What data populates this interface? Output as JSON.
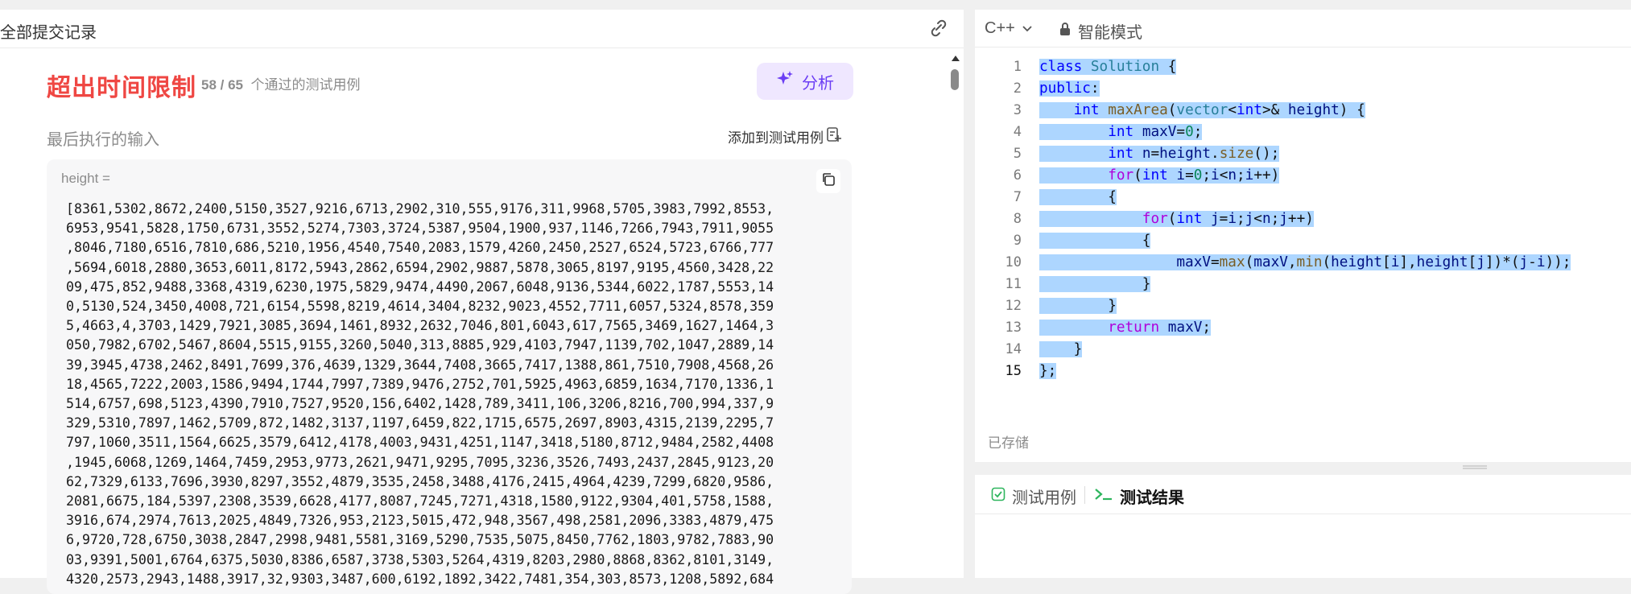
{
  "left_panel": {
    "title": "全部提交记录",
    "status": "超出时间限制",
    "passed_count": "58 / 65",
    "passed_label": "个通过的测试用例",
    "analyze_label": "分析",
    "last_input_label": "最后执行的输入",
    "add_to_tests_label": "添加到测试用例",
    "input_var_label": "height =",
    "input_lines": [
      "[8361,5302,8672,2400,5150,3527,9216,6713,2902,310,555,9176,311,9968,5705,3983,7992,8553,",
      "6953,9541,5828,1750,6731,3552,5274,7303,3724,5387,9504,1900,937,1146,7266,7943,7911,9055",
      ",8046,7180,6516,7810,686,5210,1956,4540,7540,2083,1579,4260,2450,2527,6524,5723,6766,777",
      ",5694,6018,2880,3653,6011,8172,5943,2862,6594,2902,9887,5878,3065,8197,9195,4560,3428,22",
      "09,475,852,9488,3368,4319,6230,1975,5829,9474,4490,2067,6048,9136,5344,6022,1787,5553,14",
      "0,5130,524,3450,4008,721,6154,5598,8219,4614,3404,8232,9023,4552,7711,6057,5324,8578,359",
      "5,4663,4,3703,1429,7921,3085,3694,1461,8932,2632,7046,801,6043,617,7565,3469,1627,1464,3",
      "050,7982,6702,5467,8604,5515,9155,3260,5040,313,8885,929,4103,7947,1139,702,1047,2889,14",
      "39,3945,4738,2462,8491,7699,376,4639,1329,3644,7408,3665,7417,1388,861,7510,7908,4568,26",
      "18,4565,7222,2003,1586,9494,1744,7997,7389,9476,2752,701,5925,4963,6859,1634,7170,1336,1",
      "514,6757,698,5123,4390,7910,7527,9520,156,6402,1428,789,3411,106,3206,8216,700,994,337,9",
      "329,5310,7897,1462,5709,872,1482,3137,1197,6459,822,1715,6575,2697,8903,4315,2139,2295,7",
      "797,1060,3511,1564,6625,3579,6412,4178,4003,9431,4251,1147,3418,5180,8712,9484,2582,4408",
      ",1945,6068,1269,1464,7459,2953,9773,2621,9471,9295,7095,3236,3526,7493,2437,2845,9123,20",
      "62,7329,6133,7696,3930,8297,3552,4879,3535,2458,3488,4176,2415,4964,4239,7299,6820,9586,",
      "2081,6675,184,5397,2308,3539,6628,4177,8087,7245,7271,4318,1580,9122,9304,401,5758,1588,",
      "3916,674,2974,7613,2025,4849,7326,953,2123,5015,472,948,3567,498,2581,2096,3383,4879,475",
      "6,9720,728,6750,3038,2847,2998,9481,5581,3169,5290,7535,5075,8450,7762,1803,9782,7883,90",
      "03,9391,5001,6764,6375,5030,8386,6587,3738,5303,5264,4319,8203,2980,8868,8362,8101,3149,",
      "4320,2573,2943,1488,3917,32,9303,3487,600,6192,1892,3422,7481,354,303,8573,1208,5892,684"
    ]
  },
  "editor": {
    "language": "C++",
    "mode_label": "智能模式",
    "saved_label": "已存储",
    "code_lines": [
      [
        {
          "t": "class",
          "c": "kw"
        },
        {
          "t": " "
        },
        {
          "t": "Solution",
          "c": "ty"
        },
        {
          "t": " {"
        }
      ],
      [
        {
          "t": "public",
          "c": "kw"
        },
        {
          "t": ":"
        }
      ],
      [
        {
          "t": "    "
        },
        {
          "t": "int",
          "c": "kw"
        },
        {
          "t": " "
        },
        {
          "t": "maxArea",
          "c": "fn"
        },
        {
          "t": "("
        },
        {
          "t": "vector",
          "c": "ty"
        },
        {
          "t": "<"
        },
        {
          "t": "int",
          "c": "kw"
        },
        {
          "t": ">& "
        },
        {
          "t": "height",
          "c": "var"
        },
        {
          "t": ") {"
        }
      ],
      [
        {
          "t": "        "
        },
        {
          "t": "int",
          "c": "kw"
        },
        {
          "t": " "
        },
        {
          "t": "maxV",
          "c": "var"
        },
        {
          "t": "="
        },
        {
          "t": "0",
          "c": "num"
        },
        {
          "t": ";"
        }
      ],
      [
        {
          "t": "        "
        },
        {
          "t": "int",
          "c": "kw"
        },
        {
          "t": " "
        },
        {
          "t": "n",
          "c": "var"
        },
        {
          "t": "="
        },
        {
          "t": "height",
          "c": "var"
        },
        {
          "t": "."
        },
        {
          "t": "size",
          "c": "fn"
        },
        {
          "t": "();"
        }
      ],
      [
        {
          "t": "        "
        },
        {
          "t": "for",
          "c": "cf"
        },
        {
          "t": "("
        },
        {
          "t": "int",
          "c": "kw"
        },
        {
          "t": " "
        },
        {
          "t": "i",
          "c": "var"
        },
        {
          "t": "="
        },
        {
          "t": "0",
          "c": "num"
        },
        {
          "t": ";"
        },
        {
          "t": "i",
          "c": "var"
        },
        {
          "t": "<"
        },
        {
          "t": "n",
          "c": "var"
        },
        {
          "t": ";"
        },
        {
          "t": "i",
          "c": "var"
        },
        {
          "t": "++)"
        }
      ],
      [
        {
          "t": "        {"
        }
      ],
      [
        {
          "t": "            "
        },
        {
          "t": "for",
          "c": "cf"
        },
        {
          "t": "("
        },
        {
          "t": "int",
          "c": "kw"
        },
        {
          "t": " "
        },
        {
          "t": "j",
          "c": "var"
        },
        {
          "t": "="
        },
        {
          "t": "i",
          "c": "var"
        },
        {
          "t": ";"
        },
        {
          "t": "j",
          "c": "var"
        },
        {
          "t": "<"
        },
        {
          "t": "n",
          "c": "var"
        },
        {
          "t": ";"
        },
        {
          "t": "j",
          "c": "var"
        },
        {
          "t": "++)"
        }
      ],
      [
        {
          "t": "            {"
        }
      ],
      [
        {
          "t": "                "
        },
        {
          "t": "maxV",
          "c": "var"
        },
        {
          "t": "="
        },
        {
          "t": "max",
          "c": "fn"
        },
        {
          "t": "("
        },
        {
          "t": "maxV",
          "c": "var"
        },
        {
          "t": ","
        },
        {
          "t": "min",
          "c": "fn"
        },
        {
          "t": "("
        },
        {
          "t": "height",
          "c": "var"
        },
        {
          "t": "["
        },
        {
          "t": "i",
          "c": "var"
        },
        {
          "t": "],"
        },
        {
          "t": "height",
          "c": "var"
        },
        {
          "t": "["
        },
        {
          "t": "j",
          "c": "var"
        },
        {
          "t": "])*("
        },
        {
          "t": "j",
          "c": "var"
        },
        {
          "t": "-"
        },
        {
          "t": "i",
          "c": "var"
        },
        {
          "t": "));"
        }
      ],
      [
        {
          "t": "            }"
        }
      ],
      [
        {
          "t": "        }"
        }
      ],
      [
        {
          "t": "        "
        },
        {
          "t": "return",
          "c": "cf"
        },
        {
          "t": " "
        },
        {
          "t": "maxV",
          "c": "var"
        },
        {
          "t": ";"
        }
      ],
      [
        {
          "t": "    }"
        }
      ],
      [
        {
          "t": "};"
        }
      ]
    ]
  },
  "bottom_panel": {
    "tab_tests_label": "测试用例",
    "tab_results_label": "测试结果"
  },
  "colors": {
    "status_red": "#ef4743",
    "analyze_purple": "#6b3ef4",
    "selection_blue": "#add6ff",
    "success_green": "#2db55d"
  }
}
